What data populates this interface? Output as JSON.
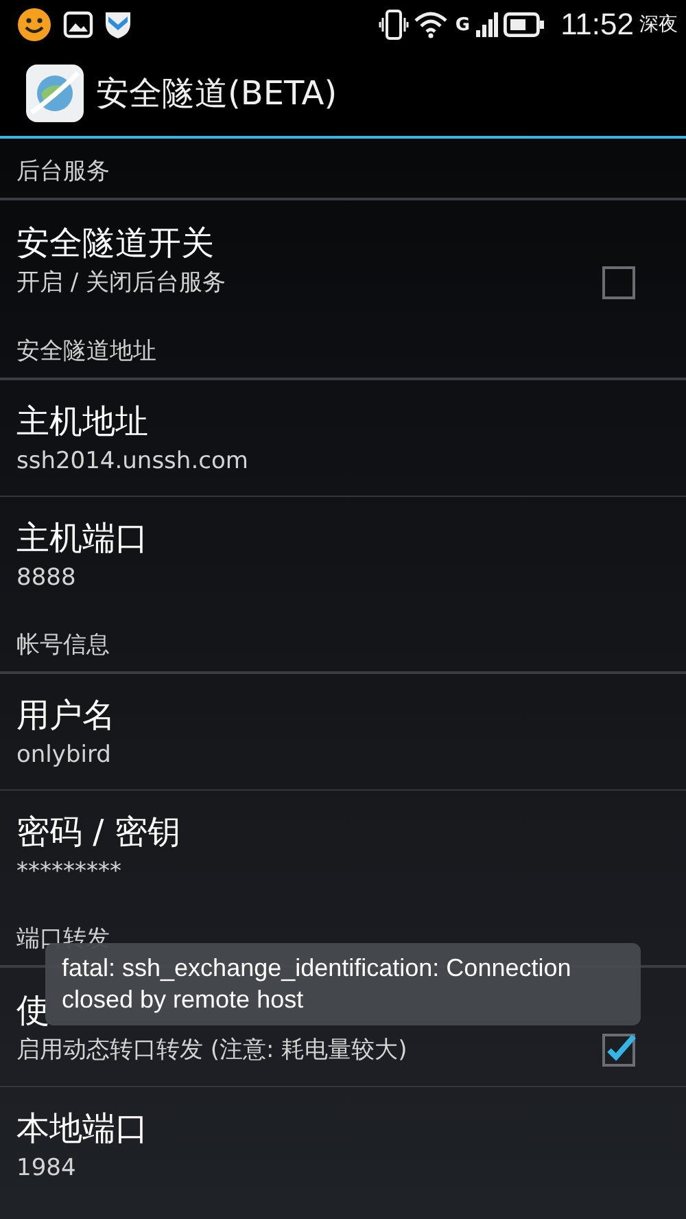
{
  "status_bar": {
    "time": "11:52",
    "period": "深夜",
    "network": "G"
  },
  "action_bar": {
    "title": "安全隧道(BETA)"
  },
  "preferences": [
    {
      "kind": "category",
      "title": "后台服务"
    },
    {
      "kind": "checkbox",
      "title": "安全隧道开关",
      "summary": "开启 / 关闭后台服务",
      "checked": false
    },
    {
      "kind": "category",
      "title": "安全隧道地址"
    },
    {
      "kind": "preference",
      "title": "主机地址",
      "summary": "ssh2014.unssh.com"
    },
    {
      "kind": "preference",
      "title": "主机端口",
      "summary": "8888"
    },
    {
      "kind": "category",
      "title": "帐号信息"
    },
    {
      "kind": "preference",
      "title": "用户名",
      "summary": "onlybird"
    },
    {
      "kind": "preference",
      "title": "密码 / 密钥",
      "summary": "*********"
    },
    {
      "kind": "category",
      "title": "端口转发"
    },
    {
      "kind": "checkbox",
      "title": "使",
      "summary": "启用动态转口转发 (注意: 耗电量较大)",
      "checked": true
    },
    {
      "kind": "preference",
      "title": "本地端口",
      "summary": "1984"
    }
  ],
  "toast": {
    "message": "fatal: ssh_exchange_identification: Connection closed by remote host"
  }
}
